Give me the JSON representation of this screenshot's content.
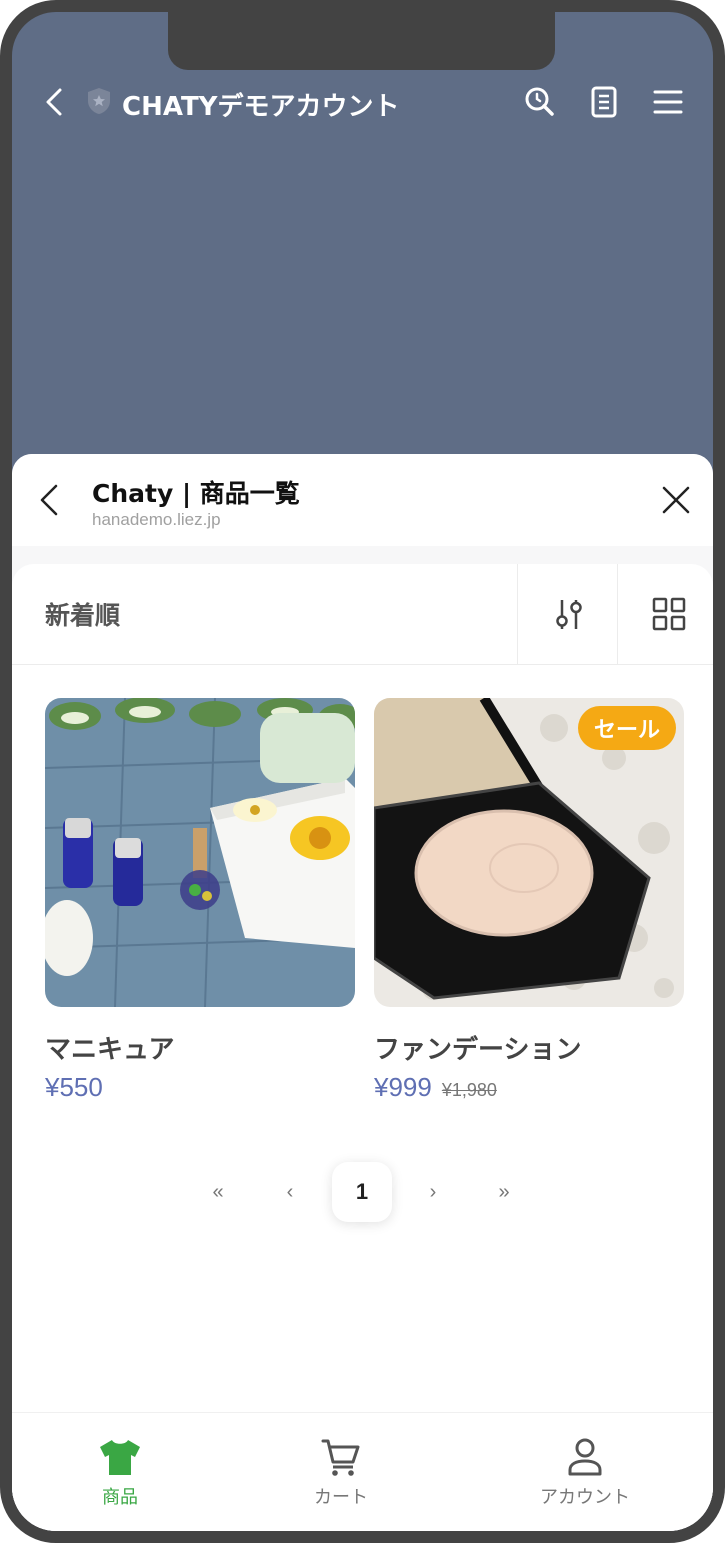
{
  "line_header": {
    "title": "CHATYデモアカウント"
  },
  "sheet": {
    "title": "Chaty | 商品一覧",
    "url": "hanademo.liez.jp"
  },
  "toolbar": {
    "sort_label": "新着順"
  },
  "products": [
    {
      "name": "マニキュア",
      "price": "¥550",
      "old_price": "",
      "badge": ""
    },
    {
      "name": "ファンデーション",
      "price": "¥999",
      "old_price": "¥1,980",
      "badge": "セール"
    }
  ],
  "pagination": {
    "first": "«",
    "prev": "‹",
    "current": "1",
    "next": "›",
    "last": "»"
  },
  "tabs": [
    {
      "label": "商品",
      "icon": "tshirt-icon",
      "active": true
    },
    {
      "label": "カート",
      "icon": "cart-icon",
      "active": false
    },
    {
      "label": "アカウント",
      "icon": "account-icon",
      "active": false
    }
  ],
  "colors": {
    "header_bg": "#5f6d86",
    "accent_green": "#3aa744",
    "price_blue": "#5f6fb3",
    "sale_orange": "#f5a914"
  }
}
